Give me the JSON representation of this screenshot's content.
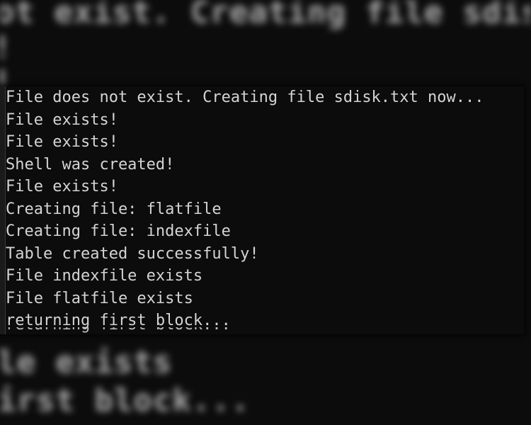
{
  "background_blur": {
    "lines": [
      "ot exist. Creating file sdisk.t",
      "!",
      "!",
      "le exists",
      "irst block..."
    ]
  },
  "console": {
    "lines": [
      "File does not exist. Creating file sdisk.txt now...",
      "File exists!",
      "File exists!",
      "Shell was created!",
      "File exists!",
      "Creating file: flatfile",
      "Creating file: indexfile",
      "Table created successfully!",
      "File indexfile exists",
      "File flatfile exists",
      "returning first block..."
    ],
    "partial_line": "returning first block..."
  },
  "colors": {
    "background": "#0c0c0c",
    "text": "#d4d4d4"
  }
}
